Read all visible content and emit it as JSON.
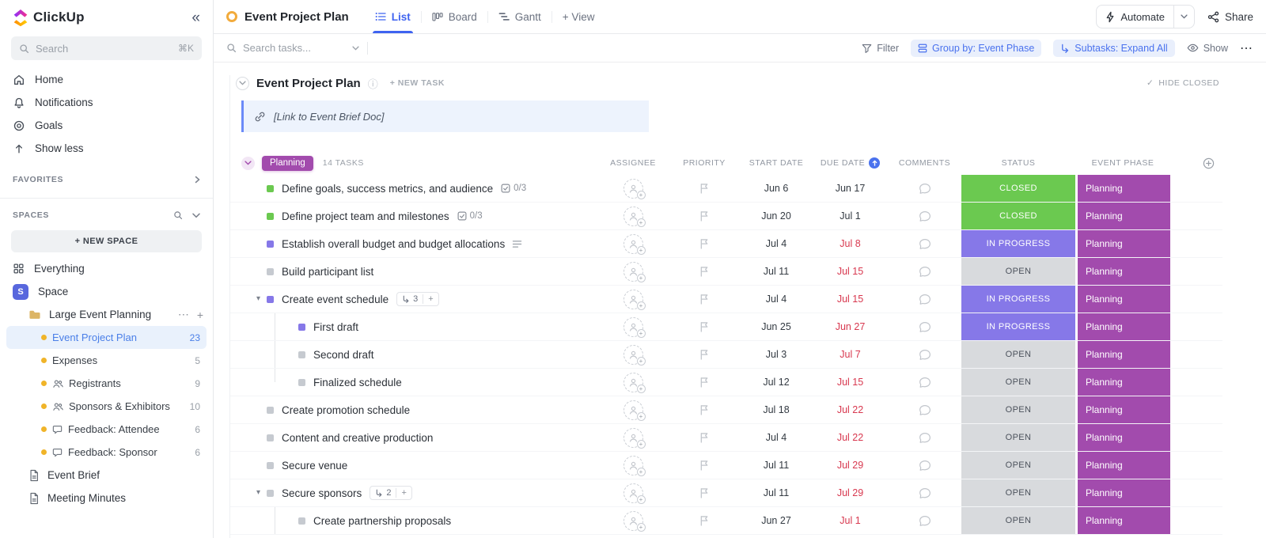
{
  "colors": {
    "accent_blue": "#4a72ee",
    "closed_green": "#6bc950",
    "in_progress_purple": "#8678e8",
    "open_gray": "#d8dadd",
    "phase_purple": "#a24bad",
    "overdue_red": "#d8384f",
    "list_dot_yellow": "#f0b429"
  },
  "sidebar": {
    "logo_text": "ClickUp",
    "search": {
      "placeholder": "Search",
      "shortcut": "⌘K"
    },
    "nav": [
      {
        "label": "Home"
      },
      {
        "label": "Notifications"
      },
      {
        "label": "Goals"
      },
      {
        "label": "Show less"
      }
    ],
    "favorites_label": "FAVORITES",
    "spaces_label": "SPACES",
    "new_space_label": "+ NEW SPACE",
    "everything_label": "Everything",
    "space_label": "Space",
    "space_avatar": "S",
    "folder_label": "Large Event Planning",
    "folder_more": "⋯",
    "folder_add": "+",
    "lists": [
      {
        "label": "Event Project Plan",
        "count": "23",
        "item_class": "selected"
      },
      {
        "label": "Expenses",
        "count": "5",
        "item_class": ""
      },
      {
        "label": "Registrants",
        "count": "9",
        "item_class": "",
        "icon_people": true
      },
      {
        "label": "Sponsors & Exhibitors",
        "count": "10",
        "item_class": "",
        "icon_people": true
      },
      {
        "label": "Feedback: Attendee",
        "count": "6",
        "item_class": "",
        "icon_comment": true
      },
      {
        "label": "Feedback: Sponsor",
        "count": "6",
        "item_class": "",
        "icon_comment": true
      }
    ],
    "docs": [
      {
        "label": "Event Brief"
      },
      {
        "label": "Meeting Minutes"
      }
    ]
  },
  "header": {
    "title": "Event Project Plan",
    "tabs": [
      {
        "label": "List"
      },
      {
        "label": "Board"
      },
      {
        "label": "Gantt"
      }
    ],
    "add_view": "+ View",
    "automate": "Automate",
    "share": "Share"
  },
  "toolbar": {
    "search_placeholder": "Search tasks...",
    "filter": "Filter",
    "group_by": "Group by: Event Phase",
    "subtasks": "Subtasks: Expand All",
    "show": "Show",
    "more": "⋯"
  },
  "list": {
    "title": "Event Project Plan",
    "info_icon": "ⓘ",
    "new_task": "+ NEW TASK",
    "hide_closed": "HIDE CLOSED",
    "banner_text": "[Link to Event Brief Doc]",
    "group_label": "Planning",
    "group_count": "14 TASKS",
    "columns": {
      "assignee": "ASSIGNEE",
      "priority": "PRIORITY",
      "start": "START DATE",
      "due": "DUE DATE",
      "comments": "COMMENTS",
      "status": "STATUS",
      "phase": "EVENT PHASE"
    }
  },
  "tasks": [
    {
      "name": "Define goals, success metrics, and audience",
      "checklist": "0/3",
      "start": "Jun 6",
      "due": "Jun 17",
      "due_class": "",
      "status": "CLOSED",
      "status_class": "closed",
      "phase": "Planning",
      "row_class": ""
    },
    {
      "name": "Define project team and milestones",
      "checklist": "0/3",
      "start": "Jun 20",
      "due": "Jul 1",
      "due_class": "",
      "status": "CLOSED",
      "status_class": "closed",
      "phase": "Planning",
      "row_class": ""
    },
    {
      "name": "Establish overall budget and budget allocations",
      "has_desc": true,
      "start": "Jul 4",
      "due": "Jul 8",
      "due_class": "overdue",
      "status": "IN PROGRESS",
      "status_class": "progress",
      "phase": "Planning",
      "row_class": ""
    },
    {
      "name": "Build participant list",
      "start": "Jul 11",
      "due": "Jul 15",
      "due_class": "overdue",
      "status": "OPEN",
      "status_class": "open",
      "phase": "Planning",
      "row_class": ""
    },
    {
      "name": "Create event schedule",
      "expandable": true,
      "subtask_count": "3",
      "start": "Jul 4",
      "due": "Jul 15",
      "due_class": "overdue",
      "status": "IN PROGRESS",
      "status_class": "progress",
      "phase": "Planning",
      "row_class": ""
    },
    {
      "name": "First draft",
      "start": "Jun 25",
      "due": "Jun 27",
      "due_class": "overdue",
      "status": "IN PROGRESS",
      "status_class": "progress",
      "phase": "Planning",
      "row_class": "sub"
    },
    {
      "name": "Second draft",
      "start": "Jul 3",
      "due": "Jul 7",
      "due_class": "overdue",
      "status": "OPEN",
      "status_class": "open",
      "phase": "Planning",
      "row_class": "sub"
    },
    {
      "name": "Finalized schedule",
      "start": "Jul 12",
      "due": "Jul 15",
      "due_class": "overdue",
      "status": "OPEN",
      "status_class": "open",
      "phase": "Planning",
      "row_class": "sub sub-last"
    },
    {
      "name": "Create promotion schedule",
      "start": "Jul 18",
      "due": "Jul 22",
      "due_class": "overdue",
      "status": "OPEN",
      "status_class": "open",
      "phase": "Planning",
      "row_class": ""
    },
    {
      "name": "Content and creative production",
      "start": "Jul 4",
      "due": "Jul 22",
      "due_class": "overdue",
      "status": "OPEN",
      "status_class": "open",
      "phase": "Planning",
      "row_class": ""
    },
    {
      "name": "Secure venue",
      "start": "Jul 11",
      "due": "Jul 29",
      "due_class": "overdue",
      "status": "OPEN",
      "status_class": "open",
      "phase": "Planning",
      "row_class": ""
    },
    {
      "name": "Secure sponsors",
      "expandable": true,
      "subtask_count": "2",
      "start": "Jul 11",
      "due": "Jul 29",
      "due_class": "overdue",
      "status": "OPEN",
      "status_class": "open",
      "phase": "Planning",
      "row_class": ""
    },
    {
      "name": "Create partnership proposals",
      "start": "Jun 27",
      "due": "Jul 1",
      "due_class": "overdue",
      "status": "OPEN",
      "status_class": "open",
      "phase": "Planning",
      "row_class": "sub"
    }
  ]
}
